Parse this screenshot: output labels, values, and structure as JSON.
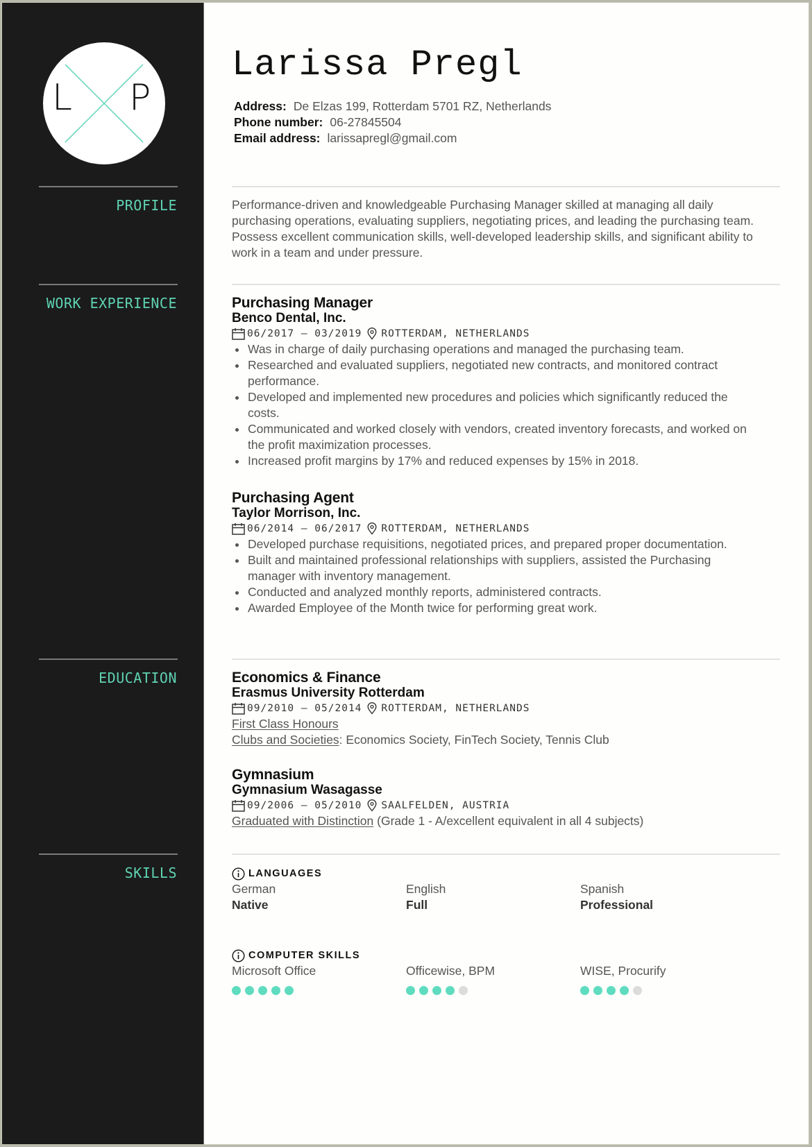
{
  "colors": {
    "accent": "#5fd3b2",
    "sidebar_bg": "#1b1b1b",
    "dot_on": "#5fdcbf",
    "dot_off": "#dcdcdc"
  },
  "monogram": {
    "first": "L",
    "second": "P"
  },
  "name": "Larissa Pregl",
  "contact": {
    "address_label": "Address:",
    "address": "De Elzas 199, Rotterdam 5701 RZ, Netherlands",
    "phone_label": "Phone number:",
    "phone": "06-27845504",
    "email_label": "Email address:",
    "email": "larissapregl@gmail.com"
  },
  "sections": {
    "profile": "PROFILE",
    "work": "WORK EXPERIENCE",
    "education": "EDUCATION",
    "skills": "SKILLS"
  },
  "profile": "Performance-driven and knowledgeable Purchasing Manager skilled at managing all daily purchasing operations, evaluating suppliers, negotiating prices, and leading the purchasing team. Possess excellent communication skills, well-developed leadership skills, and significant ability to work in a team and under pressure.",
  "work": [
    {
      "title": "Purchasing Manager",
      "company": "Benco Dental, Inc.",
      "dates": "06/2017 – 03/2019",
      "location": "ROTTERDAM, NETHERLANDS",
      "bullets": [
        "Was in charge of daily purchasing operations and managed the purchasing team.",
        "Researched and evaluated suppliers, negotiated new contracts, and monitored contract performance.",
        "Developed and implemented new procedures and policies which significantly reduced the costs.",
        "Communicated and worked closely with vendors, created inventory forecasts, and worked on the profit maximization processes.",
        "Increased profit margins by 17% and reduced expenses by 15% in 2018."
      ]
    },
    {
      "title": "Purchasing Agent",
      "company": "Taylor Morrison, Inc.",
      "dates": "06/2014 – 06/2017",
      "location": "ROTTERDAM, NETHERLANDS",
      "bullets": [
        "Developed purchase requisitions, negotiated prices, and prepared proper documentation.",
        "Built and maintained professional relationships with suppliers, assisted the Purchasing manager with inventory management.",
        "Conducted and analyzed monthly reports, administered contracts.",
        "Awarded Employee of the Month twice for performing great work."
      ]
    }
  ],
  "education": [
    {
      "degree": "Economics & Finance",
      "school": "Erasmus University Rotterdam",
      "dates": "09/2010 – 05/2014",
      "location": "ROTTERDAM, NETHERLANDS",
      "honour": "First Class Honours",
      "clubs_label": "Clubs and Societies",
      "clubs": ": Economics Society, FinTech Society, Tennis Club"
    },
    {
      "degree": "Gymnasium",
      "school": "Gymnasium Wasagasse",
      "dates": "09/2006 – 05/2010",
      "location": "SAALFELDEN, AUSTRIA",
      "honour": "Graduated with Distinction",
      "honour_note": " (Grade 1 - A/excellent equivalent in all 4 subjects)"
    }
  ],
  "skills": {
    "languages_label": "LANGUAGES",
    "languages": [
      {
        "name": "German",
        "level": "Native"
      },
      {
        "name": "English",
        "level": "Full"
      },
      {
        "name": "Spanish",
        "level": "Professional"
      }
    ],
    "computer_label": "COMPUTER SKILLS",
    "computer": [
      {
        "name": "Microsoft Office",
        "rating": 5,
        "max": 5
      },
      {
        "name": "Officewise, BPM",
        "rating": 4,
        "max": 5
      },
      {
        "name": "WISE, Procurify",
        "rating": 4,
        "max": 5
      }
    ]
  }
}
